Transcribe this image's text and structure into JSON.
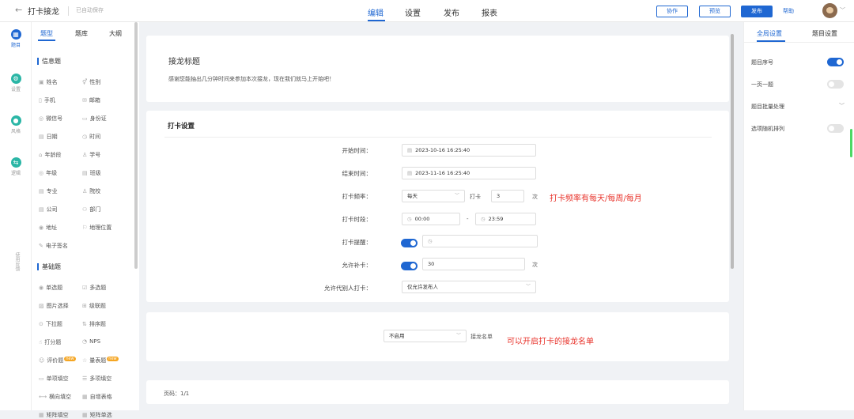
{
  "topbar": {
    "back_icon": "arrow-left-icon",
    "title": "打卡接龙",
    "saved": "已自动保存",
    "tabs": [
      "编辑",
      "设置",
      "发布",
      "报表"
    ],
    "collab": "协作",
    "preview": "预览",
    "publish": "发布",
    "help": "帮助"
  },
  "leftnav": [
    {
      "label": "题目",
      "icon": "grid-icon",
      "color": "#1f67d2"
    },
    {
      "label": "设置",
      "icon": "gear-icon",
      "color": "#2bb6a6"
    },
    {
      "label": "风格",
      "icon": "palette-icon",
      "color": "#2bb6a6"
    },
    {
      "label": "逻辑",
      "icon": "logic-icon",
      "color": "#2bb6a6"
    }
  ],
  "feedback": "使用反馈",
  "qpanel": {
    "tabs": [
      "题型",
      "题库",
      "大纲"
    ],
    "sections": {
      "info": "信息题",
      "basic": "基础题"
    },
    "info_items": [
      [
        "姓名",
        "性别"
      ],
      [
        "手机",
        "邮箱"
      ],
      [
        "微信号",
        "身份证"
      ],
      [
        "日期",
        "时间"
      ],
      [
        "年龄段",
        "学号"
      ],
      [
        "年级",
        "班级"
      ],
      [
        "专业",
        "院校"
      ],
      [
        "公司",
        "部门"
      ],
      [
        "地址",
        "地理位置"
      ],
      [
        "电子签名",
        ""
      ]
    ],
    "basic_items": [
      [
        "单选题",
        "多选题"
      ],
      [
        "图片选择",
        "级联题"
      ],
      [
        "下拉题",
        "排序题"
      ],
      [
        "打分题",
        "NPS"
      ],
      [
        "评价题",
        "量表题"
      ],
      [
        "单项填空",
        "多项填空"
      ],
      [
        "横向填空",
        "自增表格"
      ],
      [
        "矩阵填空",
        "矩阵单选"
      ]
    ],
    "badge": "new"
  },
  "main": {
    "title": "接龙标题",
    "desc": "感谢您能抽出几分钟时间来参加本次接龙，现在我们就马上开始吧！",
    "settings": {
      "title": "打卡设置",
      "start_label": "开始时间：",
      "start_value": "2023-10-16 16:25:40",
      "end_label": "结束时间：",
      "end_value": "2023-11-16 16:25:40",
      "freq_label": "打卡频率：",
      "freq_value": "每天",
      "freq_text": "打卡",
      "freq_count": "3",
      "freq_unit": "次",
      "period_label": "打卡时段：",
      "period_start": "00:00",
      "period_dash": "-",
      "period_end": "23:59",
      "remind_label": "打卡提醒：",
      "makeup_label": "允许补卡：",
      "makeup_value": "30",
      "makeup_unit": "次",
      "proxy_label": "允许代别人打卡：",
      "proxy_value": "仅允许发布人"
    },
    "list": {
      "select": "不启用",
      "label": "接龙名单"
    },
    "page": "页码：1/1",
    "annotation1": "打卡频率有每天/每周/每月",
    "annotation2": "可以开启打卡的接龙名单"
  },
  "rpanel": {
    "tabs": [
      "全局设置",
      "题目设置"
    ],
    "items": [
      "题目序号",
      "一页一题",
      "题目批量处理",
      "选项随机排列"
    ]
  },
  "colors": {
    "accent": "#1f67d2",
    "annotation": "#e8332b"
  }
}
